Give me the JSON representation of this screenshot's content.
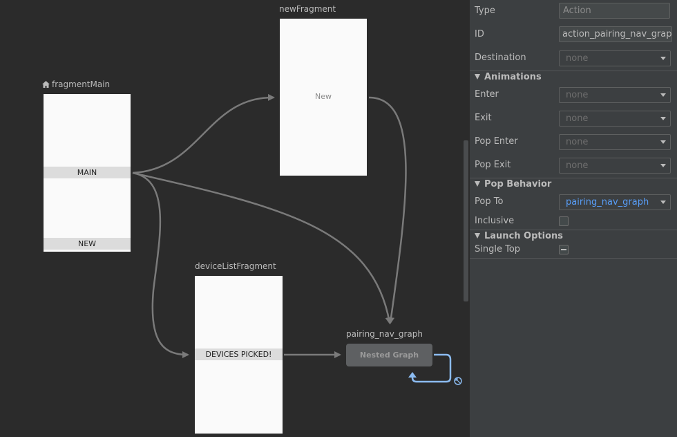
{
  "graph": {
    "fragments": {
      "fragment_main": {
        "title": "fragmentMain",
        "actions": [
          "MAIN",
          "NEW"
        ]
      },
      "new_fragment": {
        "title": "newFragment",
        "placeholder": "New"
      },
      "device_list_fragment": {
        "title": "deviceListFragment",
        "actions": [
          "DEVICES PICKED!"
        ]
      }
    },
    "nested_graph": {
      "title": "pairing_nav_graph",
      "label": "Nested Graph"
    },
    "colors": {
      "edge": "#7a7a7a",
      "selected_edge": "#8cbcf2"
    }
  },
  "panel": {
    "type": {
      "label": "Type",
      "value": "Action"
    },
    "id": {
      "label": "ID",
      "value": "action_pairing_nav_graph_"
    },
    "destination": {
      "label": "Destination",
      "value": "none"
    },
    "animations": {
      "header": "Animations",
      "enter": {
        "label": "Enter",
        "value": "none"
      },
      "exit": {
        "label": "Exit",
        "value": "none"
      },
      "pop_enter": {
        "label": "Pop Enter",
        "value": "none"
      },
      "pop_exit": {
        "label": "Pop Exit",
        "value": "none"
      }
    },
    "pop_behavior": {
      "header": "Pop Behavior",
      "pop_to": {
        "label": "Pop To",
        "value": "pairing_nav_graph"
      },
      "inclusive": {
        "label": "Inclusive",
        "checked": false
      }
    },
    "launch_options": {
      "header": "Launch Options",
      "single_top": {
        "label": "Single Top",
        "state": "indeterminate"
      }
    }
  }
}
